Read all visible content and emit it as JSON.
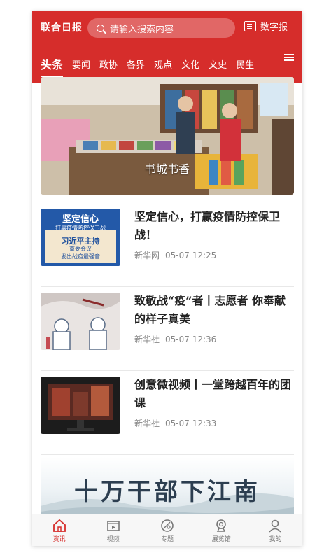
{
  "header": {
    "logo": "联合日报",
    "search_placeholder": "请输入搜索内容",
    "digital_label": "数字报",
    "tabs": [
      "头条",
      "要闻",
      "政协",
      "各界",
      "观点",
      "文化",
      "文史",
      "民生"
    ],
    "active_tab": "头条"
  },
  "hero": {
    "caption": "书城书香"
  },
  "news": [
    {
      "title": "坚定信心，打赢疫情防控保卫战！",
      "source": "新华网",
      "time": "05-07 12:25",
      "thumb_lines": [
        "坚定信心",
        "打赢疫情防控保卫战",
        "习近平主持",
        "重要会议",
        "发出战疫最强音"
      ]
    },
    {
      "title": "致敬战“疫”者丨志愿者 你奉献的样子真美",
      "source": "新华社",
      "time": "05-07 12:36"
    },
    {
      "title": "创意微视频丨一堂跨越百年的团课",
      "source": "新华社",
      "time": "05-07 12:33"
    }
  ],
  "banner": {
    "text": "十万干部下江南"
  },
  "bottom_nav": [
    {
      "label": "资讯",
      "icon": "home-icon"
    },
    {
      "label": "视频",
      "icon": "video-icon"
    },
    {
      "label": "专题",
      "icon": "topic-icon"
    },
    {
      "label": "展览馆",
      "icon": "exhibition-icon"
    },
    {
      "label": "我的",
      "icon": "user-icon"
    }
  ],
  "colors": {
    "brand_red": "#d62d2b",
    "active_nav": "#d62d2b"
  }
}
